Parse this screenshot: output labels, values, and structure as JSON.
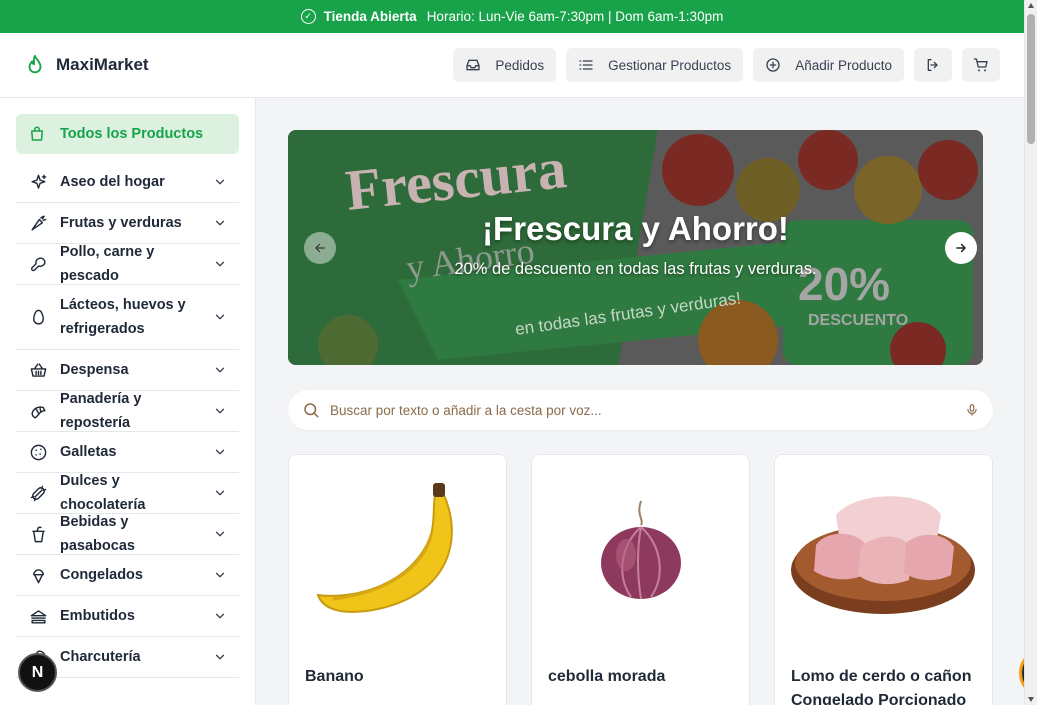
{
  "topbar": {
    "status": "Tienda Abierta",
    "hours": "Horario: Lun-Vie 6am-7:30pm | Dom 6am-1:30pm"
  },
  "header": {
    "brand": "MaxiMarket",
    "nav": {
      "orders": "Pedidos",
      "manage": "Gestionar Productos",
      "add": "Añadir Producto"
    }
  },
  "sidebar": {
    "all_products": "Todos los Productos",
    "categories": [
      {
        "label": "Aseo del hogar",
        "icon": "sparkles-icon"
      },
      {
        "label": "Frutas y verduras",
        "icon": "carrot-icon"
      },
      {
        "label": "Pollo, carne y pescado",
        "icon": "drumstick-icon"
      },
      {
        "label": "Lácteos, huevos y refrigerados",
        "icon": "egg-icon"
      },
      {
        "label": "Despensa",
        "icon": "basket-icon"
      },
      {
        "label": "Panadería y repostería",
        "icon": "croissant-icon"
      },
      {
        "label": "Galletas",
        "icon": "cookie-icon"
      },
      {
        "label": "Dulces y chocolatería",
        "icon": "candy-icon"
      },
      {
        "label": "Bebidas y pasabocas",
        "icon": "cup-icon"
      },
      {
        "label": "Congelados",
        "icon": "ice-cream-icon"
      },
      {
        "label": "Embutidos",
        "icon": "sandwich-icon"
      },
      {
        "label": "Charcutería",
        "icon": "ham-icon"
      }
    ]
  },
  "carousel": {
    "title": "¡Frescura y Ahorro!",
    "subtitle": "20% de descuento en todas las frutas y verduras.",
    "image_text": {
      "brand": "Frescura",
      "sub": "y Ahorro",
      "ribbon": "en todas las frutas y verduras!",
      "percent": "20%",
      "discount": "DESCUENTO"
    }
  },
  "search": {
    "placeholder": "Buscar por texto o añadir a la cesta por voz..."
  },
  "products": [
    {
      "name": "Banano"
    },
    {
      "name": "cebolla morada"
    },
    {
      "name": "Lomo de cerdo o cañon Congelado Porcionado"
    }
  ],
  "fab": {
    "label": "N"
  },
  "colors": {
    "brand_green": "#18a34a",
    "active_bg": "#dcf1df"
  }
}
